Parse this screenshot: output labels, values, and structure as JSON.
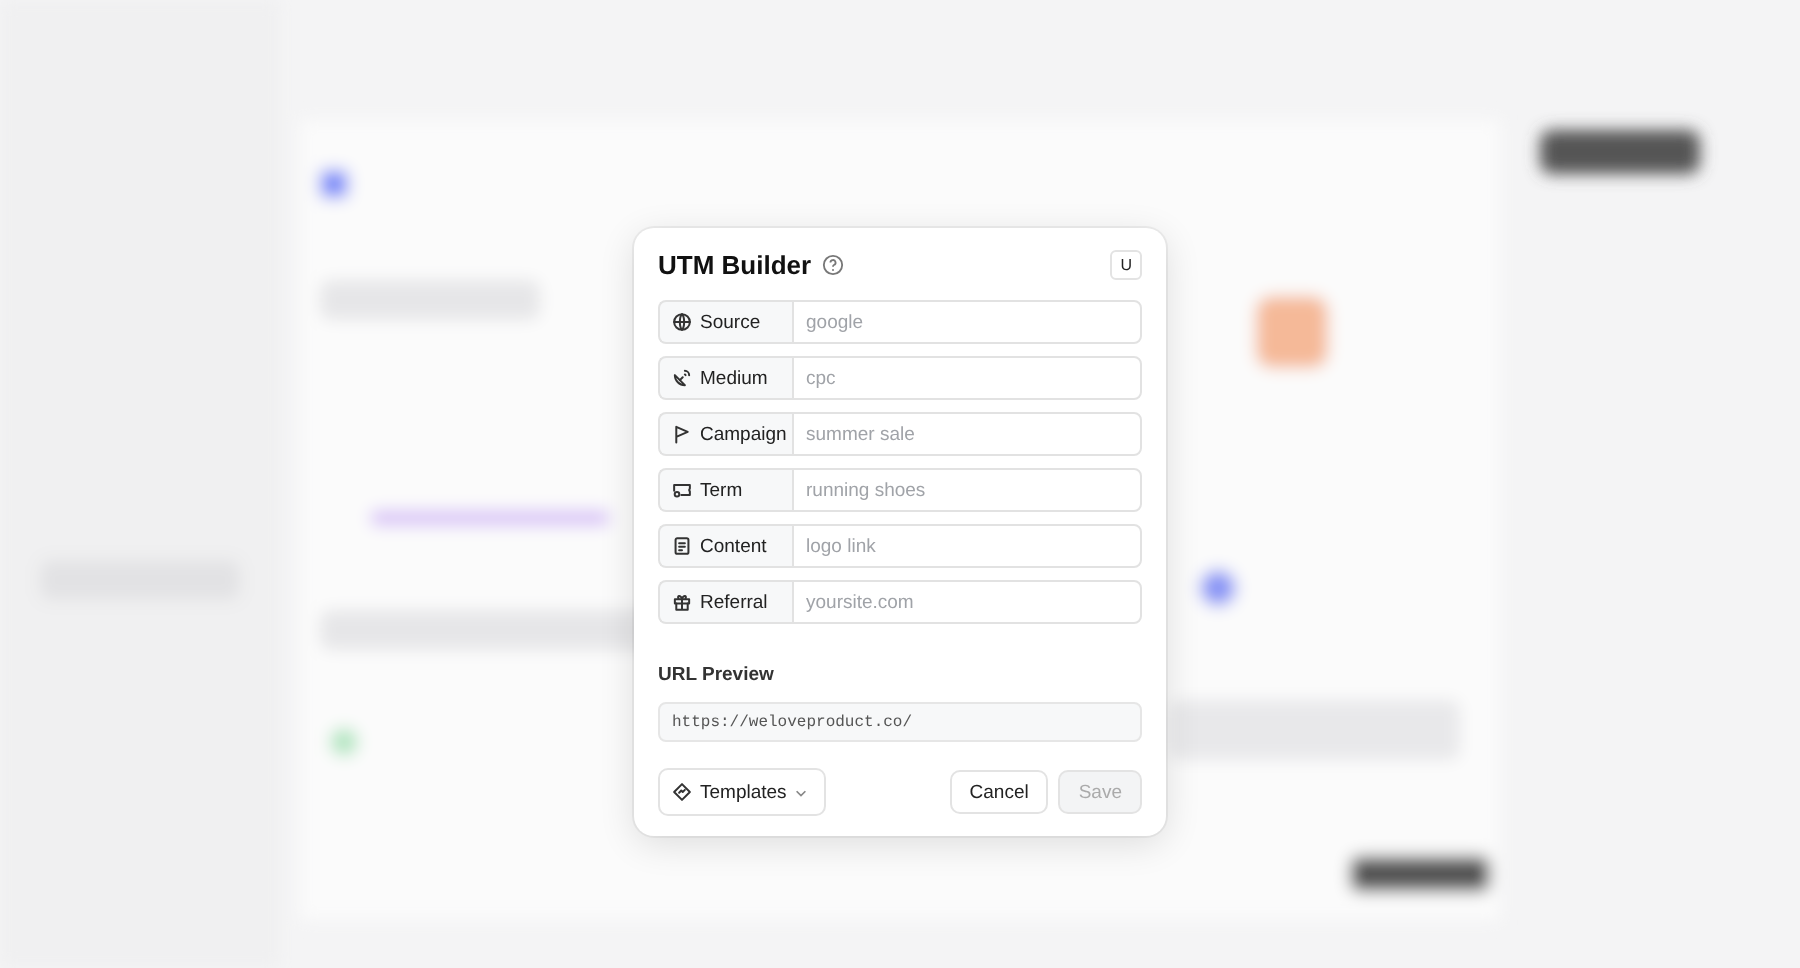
{
  "dialog": {
    "title": "UTM Builder",
    "shortcut": "U",
    "fields": [
      {
        "kind": "globe",
        "label": "Source",
        "placeholder": "google"
      },
      {
        "kind": "dish",
        "label": "Medium",
        "placeholder": "cpc"
      },
      {
        "kind": "flag",
        "label": "Campaign",
        "placeholder": "summer sale"
      },
      {
        "kind": "ticket",
        "label": "Term",
        "placeholder": "running shoes"
      },
      {
        "kind": "document",
        "label": "Content",
        "placeholder": "logo link"
      },
      {
        "kind": "gift",
        "label": "Referral",
        "placeholder": "yoursite.com"
      }
    ],
    "preview": {
      "label": "URL Preview",
      "value": "https://weloveproduct.co/"
    },
    "templates": "Templates",
    "buttons": [
      {
        "label": "Cancel",
        "disabled": false
      },
      {
        "label": "Save",
        "disabled": true
      }
    ]
  }
}
